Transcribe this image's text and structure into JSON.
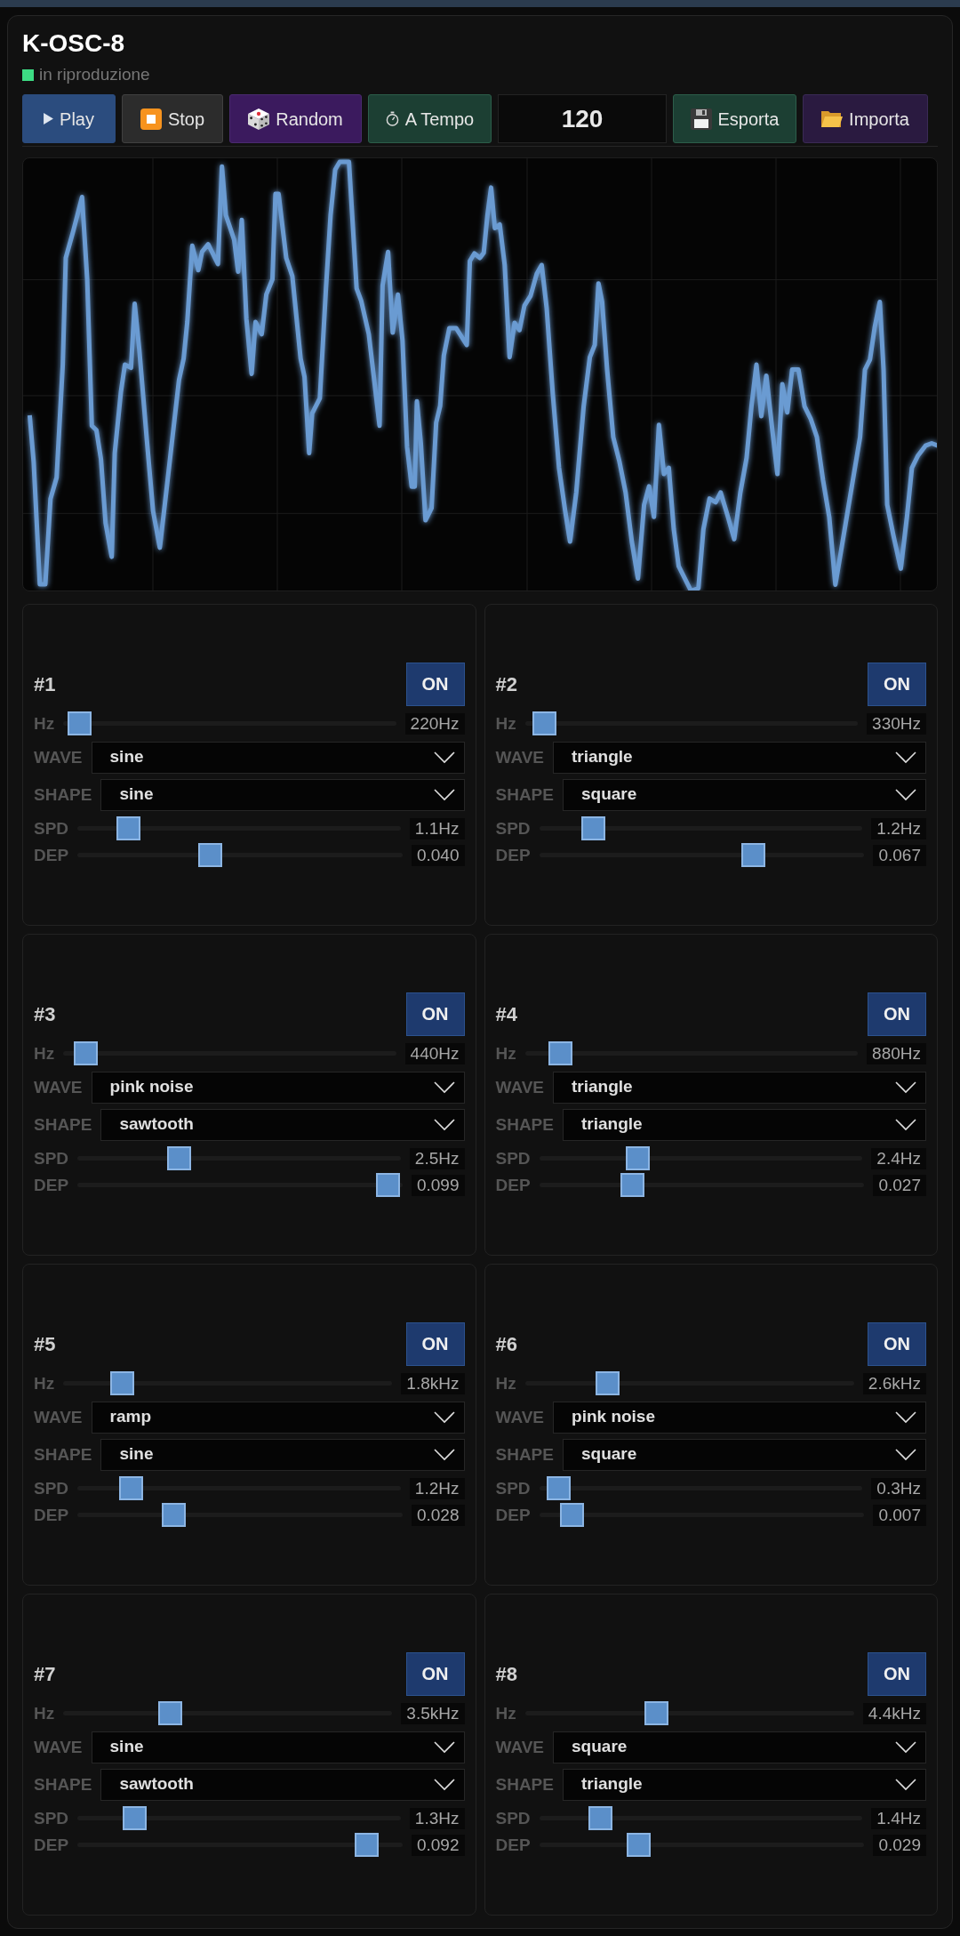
{
  "app": {
    "title": "K-OSC-8",
    "status": {
      "label": "in riproduzione",
      "playing": true
    }
  },
  "toolbar": [
    {
      "kind": "play",
      "label": "Play"
    },
    {
      "kind": "stop",
      "label": "Stop"
    },
    {
      "kind": "random",
      "label": "Random"
    },
    {
      "kind": "tempo",
      "label": "A Tempo"
    },
    {
      "kind": "bpm",
      "value": "120"
    },
    {
      "kind": "export",
      "label": "Esporta"
    },
    {
      "kind": "import",
      "label": "Importa"
    }
  ],
  "oscillators": [
    {
      "title": "#1",
      "power": {
        "label": "ON",
        "on": true
      },
      "controls": [
        {
          "kind": "slider",
          "label": "Hz",
          "level": 0.015,
          "reading": "220Hz"
        },
        {
          "kind": "select",
          "label": "WAVE",
          "value": "sine"
        },
        {
          "kind": "select",
          "label": "SHAPE",
          "value": "sine"
        },
        {
          "kind": "slider",
          "label": "SPD",
          "level": 0.13,
          "reading": "1.1Hz"
        },
        {
          "kind": "slider",
          "label": "DEP",
          "level": 0.4,
          "reading": "0.040"
        }
      ]
    },
    {
      "title": "#2",
      "power": {
        "label": "ON",
        "on": true
      },
      "controls": [
        {
          "kind": "slider",
          "label": "Hz",
          "level": 0.025,
          "reading": "330Hz"
        },
        {
          "kind": "select",
          "label": "WAVE",
          "value": "triangle"
        },
        {
          "kind": "select",
          "label": "SHAPE",
          "value": "square"
        },
        {
          "kind": "slider",
          "label": "SPD",
          "level": 0.14,
          "reading": "1.2Hz"
        },
        {
          "kind": "slider",
          "label": "DEP",
          "level": 0.67,
          "reading": "0.067"
        }
      ]
    },
    {
      "title": "#3",
      "power": {
        "label": "ON",
        "on": true
      },
      "controls": [
        {
          "kind": "slider",
          "label": "Hz",
          "level": 0.035,
          "reading": "440Hz"
        },
        {
          "kind": "select",
          "label": "WAVE",
          "value": "pink noise"
        },
        {
          "kind": "select",
          "label": "SHAPE",
          "value": "sawtooth"
        },
        {
          "kind": "slider",
          "label": "SPD",
          "level": 0.3,
          "reading": "2.5Hz"
        },
        {
          "kind": "slider",
          "label": "DEP",
          "level": 0.99,
          "reading": "0.099"
        }
      ]
    },
    {
      "title": "#4",
      "power": {
        "label": "ON",
        "on": true
      },
      "controls": [
        {
          "kind": "slider",
          "label": "Hz",
          "level": 0.075,
          "reading": "880Hz"
        },
        {
          "kind": "select",
          "label": "WAVE",
          "value": "triangle"
        },
        {
          "kind": "select",
          "label": "SHAPE",
          "value": "triangle"
        },
        {
          "kind": "slider",
          "label": "SPD",
          "level": 0.29,
          "reading": "2.4Hz"
        },
        {
          "kind": "slider",
          "label": "DEP",
          "level": 0.27,
          "reading": "0.027"
        }
      ]
    },
    {
      "title": "#5",
      "power": {
        "label": "ON",
        "on": true
      },
      "controls": [
        {
          "kind": "slider",
          "label": "Hz",
          "level": 0.155,
          "reading": "1.8kHz"
        },
        {
          "kind": "select",
          "label": "WAVE",
          "value": "ramp"
        },
        {
          "kind": "select",
          "label": "SHAPE",
          "value": "sine"
        },
        {
          "kind": "slider",
          "label": "SPD",
          "level": 0.14,
          "reading": "1.2Hz"
        },
        {
          "kind": "slider",
          "label": "DEP",
          "level": 0.28,
          "reading": "0.028"
        }
      ]
    },
    {
      "title": "#6",
      "power": {
        "label": "ON",
        "on": true
      },
      "controls": [
        {
          "kind": "slider",
          "label": "Hz",
          "level": 0.23,
          "reading": "2.6kHz"
        },
        {
          "kind": "select",
          "label": "WAVE",
          "value": "pink noise"
        },
        {
          "kind": "select",
          "label": "SHAPE",
          "value": "square"
        },
        {
          "kind": "slider",
          "label": "SPD",
          "level": 0.025,
          "reading": "0.3Hz"
        },
        {
          "kind": "slider",
          "label": "DEP",
          "level": 0.07,
          "reading": "0.007"
        }
      ]
    },
    {
      "title": "#7",
      "power": {
        "label": "ON",
        "on": true
      },
      "controls": [
        {
          "kind": "slider",
          "label": "Hz",
          "level": 0.31,
          "reading": "3.5kHz"
        },
        {
          "kind": "select",
          "label": "WAVE",
          "value": "sine"
        },
        {
          "kind": "select",
          "label": "SHAPE",
          "value": "sawtooth"
        },
        {
          "kind": "slider",
          "label": "SPD",
          "level": 0.15,
          "reading": "1.3Hz"
        },
        {
          "kind": "slider",
          "label": "DEP",
          "level": 0.92,
          "reading": "0.092"
        }
      ]
    },
    {
      "title": "#8",
      "power": {
        "label": "ON",
        "on": true
      },
      "controls": [
        {
          "kind": "slider",
          "label": "Hz",
          "level": 0.39,
          "reading": "4.4kHz"
        },
        {
          "kind": "select",
          "label": "WAVE",
          "value": "square"
        },
        {
          "kind": "select",
          "label": "SHAPE",
          "value": "triangle"
        },
        {
          "kind": "slider",
          "label": "SPD",
          "level": 0.165,
          "reading": "1.4Hz"
        },
        {
          "kind": "slider",
          "label": "DEP",
          "level": 0.29,
          "reading": "0.029"
        }
      ]
    }
  ]
}
